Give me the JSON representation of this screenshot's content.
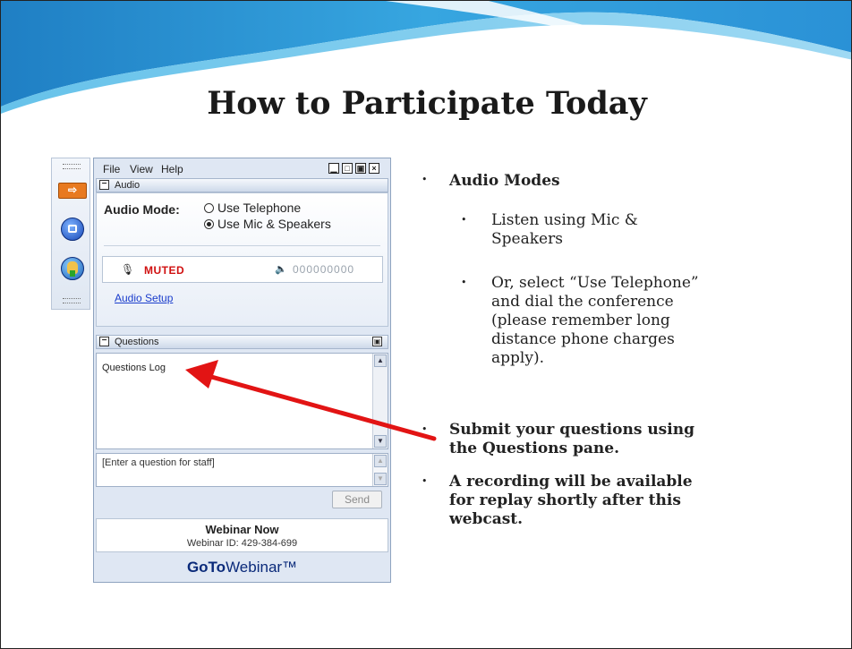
{
  "slide": {
    "title": "How to Participate Today"
  },
  "app": {
    "menus": [
      "File",
      "View",
      "Help"
    ],
    "window_buttons": [
      "minimize",
      "restore",
      "maximize",
      "close"
    ],
    "audio": {
      "section_label": "Audio",
      "mode_label": "Audio Mode:",
      "option_telephone": "Use Telephone",
      "option_mic": "Use Mic & Speakers",
      "selected": "Use Mic & Speakers",
      "mic_status": "MUTED",
      "level_meter": "000000000",
      "setup_link": "Audio Setup"
    },
    "questions": {
      "section_label": "Questions",
      "log_text": "Questions Log",
      "input_placeholder": "[Enter a question for staff]",
      "send_label": "Send"
    },
    "webinar": {
      "status": "Webinar Now",
      "id_text": "Webinar ID: 429-384-699",
      "brand_bold": "GoTo",
      "brand_rest": "Webinar™"
    },
    "colors": {
      "muted_red": "#d01010",
      "link_blue": "#1a3ccc",
      "brand_navy": "#0a2a7a",
      "arrow_red": "#e21414"
    }
  },
  "bullets": {
    "b1": "Audio Modes",
    "b1a": [
      "Listen using Mic &",
      "Speakers"
    ],
    "b1b": [
      "Or, select “Use Telephone”",
      "and dial the conference",
      "(please remember long",
      "distance phone charges",
      "apply)."
    ],
    "b2": [
      "Submit your questions using",
      "the Questions pane."
    ],
    "b3": [
      "A recording will be available",
      "for replay shortly after this",
      "webcast."
    ]
  }
}
